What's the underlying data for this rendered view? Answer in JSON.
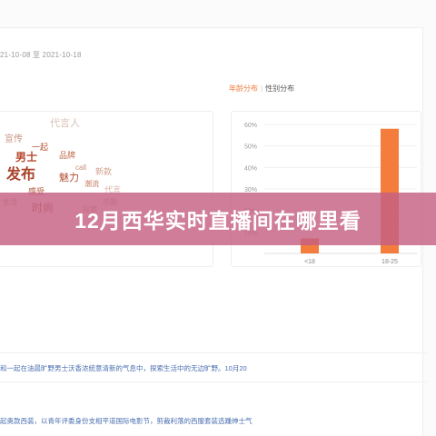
{
  "header": {
    "date_range": "21-10-08 至 2021-10-18"
  },
  "tabs": {
    "active": "年龄分布",
    "separator": "|",
    "inactive": "性别分布"
  },
  "word_cloud": {
    "words": [
      "代言人",
      "宣传",
      "一起",
      "call",
      "男士",
      "品牌",
      "新款",
      "潮流",
      "发布",
      "感受",
      "魅力",
      "乐趣",
      "生活",
      "探索",
      "时尚",
      "代言"
    ]
  },
  "chart_data": {
    "type": "bar",
    "categories": [
      "<18",
      "18-25"
    ],
    "values": [
      7,
      58
    ],
    "y_ticks": [
      "60%",
      "50%",
      "40%",
      "30%",
      "20%",
      "10%"
    ],
    "ylim": [
      0,
      60
    ],
    "grid": true,
    "bar_color": "#f47c3c"
  },
  "banner": {
    "title": "12月西华实时直播间在哪里看"
  },
  "feed": [
    "和一起在油晨旷野男士沃香浓统意清新的气息中，探索生活中的无边旷野。10月20",
    "起奥款西装，以青年评委身份支相平道国际电影节，剪裁利落的西服套装选踵绅士气"
  ],
  "colors": {
    "accent": "#f07b3f",
    "bar": "#f47c3c",
    "banner": "#c46082",
    "link": "#4a6fb0"
  }
}
